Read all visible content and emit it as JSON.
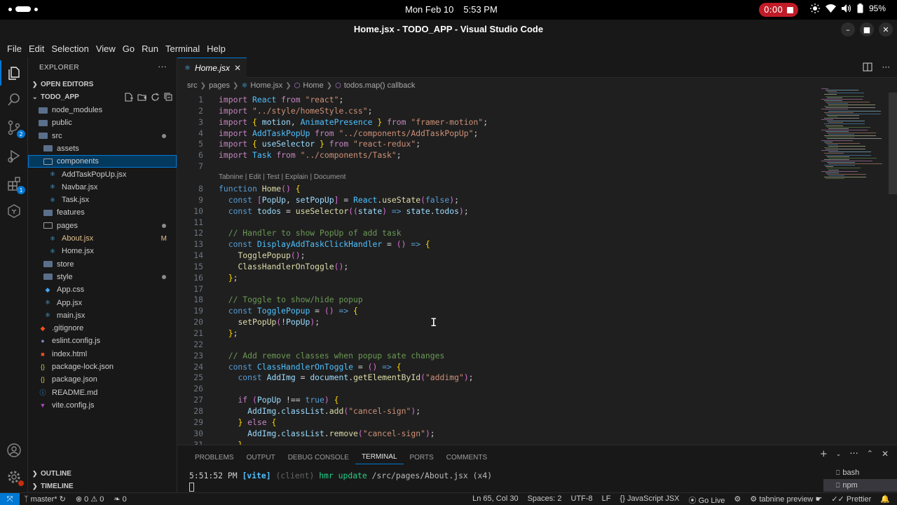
{
  "system": {
    "date": "Mon Feb 10",
    "time": "5:53 PM",
    "recording": "0:00",
    "battery": "95%"
  },
  "window": {
    "title": "Home.jsx - TODO_APP - Visual Studio Code"
  },
  "menu": [
    "File",
    "Edit",
    "Selection",
    "View",
    "Go",
    "Run",
    "Terminal",
    "Help"
  ],
  "activity": {
    "source_control_badge": "2",
    "extensions_badge": "1"
  },
  "explorer": {
    "header": "EXPLORER",
    "more": "···",
    "open_editors": "OPEN EDITORS",
    "project": "TODO_APP",
    "outline": "OUTLINE",
    "timeline": "TIMELINE",
    "tree": [
      {
        "label": "node_modules",
        "kind": "folder",
        "depth": 0
      },
      {
        "label": "public",
        "kind": "folder",
        "depth": 0
      },
      {
        "label": "src",
        "kind": "folder",
        "depth": 0,
        "dot": true
      },
      {
        "label": "assets",
        "kind": "folder",
        "depth": 1
      },
      {
        "label": "components",
        "kind": "folder-open",
        "depth": 1,
        "selected": true
      },
      {
        "label": "AddTaskPopUp.jsx",
        "kind": "react",
        "depth": 2
      },
      {
        "label": "Navbar.jsx",
        "kind": "react",
        "depth": 2
      },
      {
        "label": "Task.jsx",
        "kind": "react",
        "depth": 2
      },
      {
        "label": "features",
        "kind": "folder",
        "depth": 1
      },
      {
        "label": "pages",
        "kind": "folder-open",
        "depth": 1,
        "dot": true
      },
      {
        "label": "About.jsx",
        "kind": "react",
        "depth": 2,
        "modified": "M"
      },
      {
        "label": "Home.jsx",
        "kind": "react",
        "depth": 2
      },
      {
        "label": "store",
        "kind": "folder",
        "depth": 1
      },
      {
        "label": "style",
        "kind": "folder",
        "depth": 1,
        "dot": true
      },
      {
        "label": "App.css",
        "kind": "css",
        "depth": 1
      },
      {
        "label": "App.jsx",
        "kind": "react",
        "depth": 1
      },
      {
        "label": "main.jsx",
        "kind": "react",
        "depth": 1
      },
      {
        "label": ".gitignore",
        "kind": "git",
        "depth": 0
      },
      {
        "label": "eslint.config.js",
        "kind": "eslint",
        "depth": 0
      },
      {
        "label": "index.html",
        "kind": "html",
        "depth": 0
      },
      {
        "label": "package-lock.json",
        "kind": "json",
        "depth": 0
      },
      {
        "label": "package.json",
        "kind": "json",
        "depth": 0
      },
      {
        "label": "README.md",
        "kind": "info",
        "depth": 0
      },
      {
        "label": "vite.config.js",
        "kind": "vite",
        "depth": 0
      }
    ]
  },
  "editor": {
    "tab": "Home.jsx",
    "breadcrumb": [
      "src",
      "pages",
      "Home.jsx",
      "Home",
      "todos.map() callback"
    ],
    "codelens": "Tabnine | Edit | Test | Explain | Document",
    "lines": [
      {
        "n": "1",
        "code": "import React from \"react\";"
      },
      {
        "n": "2",
        "code": "import \"../style/homeStyle.css\";"
      },
      {
        "n": "3",
        "code": "import { motion, AnimatePresence } from \"framer-motion\";"
      },
      {
        "n": "4",
        "code": "import AddTaskPopUp from \"../components/AddTaskPopUp\";"
      },
      {
        "n": "5",
        "code": "import { useSelector } from \"react-redux\";"
      },
      {
        "n": "6",
        "code": "import Task from \"../components/Task\";"
      },
      {
        "n": "7",
        "code": ""
      },
      {
        "n": "8",
        "code": "function Home() {"
      },
      {
        "n": "9",
        "code": "  const [PopUp, setPopUp] = React.useState(false);"
      },
      {
        "n": "10",
        "code": "  const todos = useSelector((state) => state.todos);"
      },
      {
        "n": "11",
        "code": ""
      },
      {
        "n": "12",
        "code": "  // Handler to show PopUp of add task"
      },
      {
        "n": "13",
        "code": "  const DisplayAddTaskClickHandler = () => {"
      },
      {
        "n": "14",
        "code": "    TogglePopup();"
      },
      {
        "n": "15",
        "code": "    ClassHandlerOnToggle();"
      },
      {
        "n": "16",
        "code": "  };"
      },
      {
        "n": "17",
        "code": ""
      },
      {
        "n": "18",
        "code": "  // Toggle to show/hide popup"
      },
      {
        "n": "19",
        "code": "  const TogglePopup = () => {"
      },
      {
        "n": "20",
        "code": "    setPopUp(!PopUp);"
      },
      {
        "n": "21",
        "code": "  };"
      },
      {
        "n": "22",
        "code": ""
      },
      {
        "n": "23",
        "code": "  // Add remove classes when popup sate changes"
      },
      {
        "n": "24",
        "code": "  const ClassHandlerOnToggle = () => {"
      },
      {
        "n": "25",
        "code": "    const AddImg = document.getElementById(\"addimg\");"
      },
      {
        "n": "26",
        "code": ""
      },
      {
        "n": "27",
        "code": "    if (PopUp !== true) {"
      },
      {
        "n": "28",
        "code": "      AddImg.classList.add(\"cancel-sign\");"
      },
      {
        "n": "29",
        "code": "    } else {"
      },
      {
        "n": "30",
        "code": "      AddImg.classList.remove(\"cancel-sign\");"
      },
      {
        "n": "31",
        "code": "    }"
      }
    ]
  },
  "panel": {
    "tabs": [
      "PROBLEMS",
      "OUTPUT",
      "DEBUG CONSOLE",
      "TERMINAL",
      "PORTS",
      "COMMENTS"
    ],
    "active_tab": "TERMINAL",
    "terminal": {
      "time": "5:51:52 PM",
      "source": "[vite]",
      "client": "(client)",
      "message": "hmr update",
      "path": "/src/pages/About.jsx (x4)"
    },
    "terminals": [
      "bash",
      "npm"
    ]
  },
  "status": {
    "branch": "master*",
    "errors": "0",
    "warnings": "0",
    "ports": "0",
    "position": "Ln 65, Col 30",
    "spaces": "Spaces: 2",
    "encoding": "UTF-8",
    "eol": "LF",
    "language": "JavaScript JSX",
    "golive": "Go Live",
    "tabnine": "tabnine preview",
    "prettier": "Prettier"
  }
}
